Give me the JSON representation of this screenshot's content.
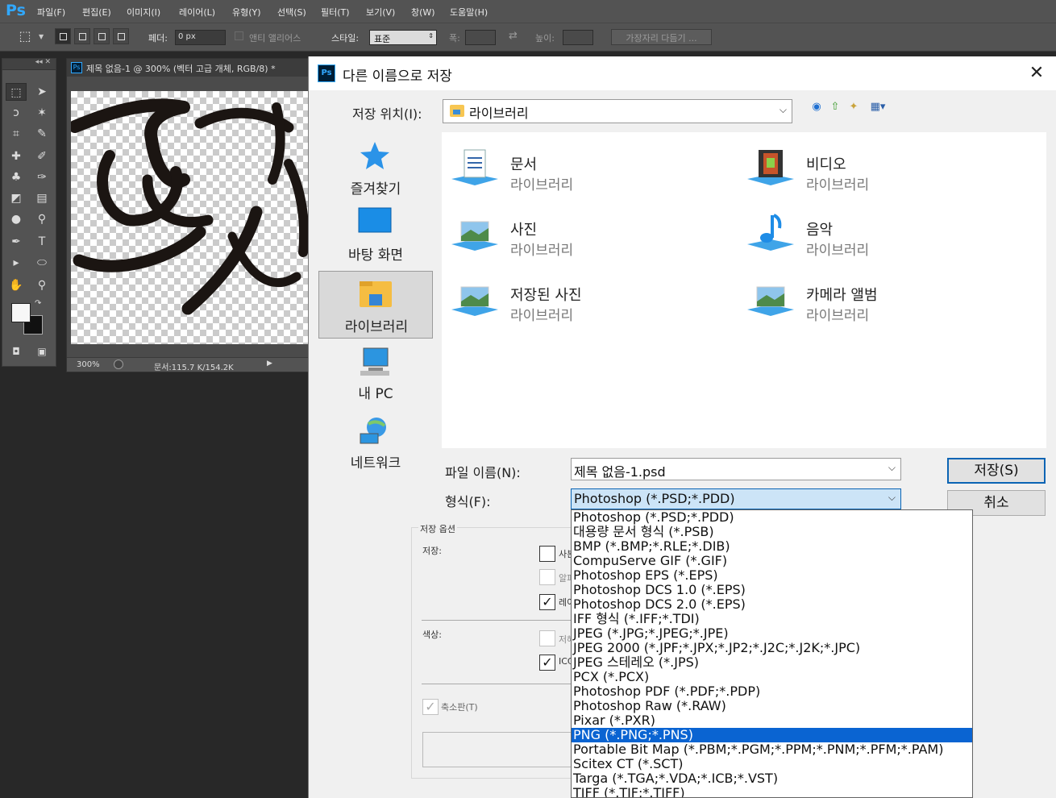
{
  "app": {
    "logo": "Ps",
    "menu": [
      "파일(F)",
      "편집(E)",
      "이미지(I)",
      "레이어(L)",
      "유형(Y)",
      "선택(S)",
      "필터(T)",
      "보기(V)",
      "창(W)",
      "도움말(H)"
    ]
  },
  "options_bar": {
    "feather_label": "페더:",
    "feather_value": "0 px",
    "antialias_label": "앤티 앨리어스",
    "style_label": "스타일:",
    "style_value": "표준",
    "width_label": "폭:",
    "height_label": "높이:",
    "refine_edge": "가장자리 다듬기 ..."
  },
  "toolbox": {
    "collapse": "◂◂ ✕"
  },
  "document": {
    "tab_title": "제목 없음-1 @ 300% (벡터 고급 개체, RGB/8) *",
    "zoom": "300%",
    "doc_size": "문서:115.7 K/154.2K"
  },
  "dialog": {
    "title": "다른 이름으로 저장",
    "save_in_label": "저장 위치(I):",
    "save_in_value": "라이브러리",
    "places": [
      {
        "label": "즐겨찾기",
        "icon": "star-icon"
      },
      {
        "label": "바탕 화면",
        "icon": "desktop-icon"
      },
      {
        "label": "라이브러리",
        "icon": "libraries-icon"
      },
      {
        "label": "내 PC",
        "icon": "computer-icon"
      },
      {
        "label": "네트워크",
        "icon": "network-icon"
      }
    ],
    "libraries": [
      {
        "name": "문서",
        "sub": "라이브러리",
        "icon": "documents-library-icon"
      },
      {
        "name": "비디오",
        "sub": "라이브러리",
        "icon": "videos-library-icon"
      },
      {
        "name": "사진",
        "sub": "라이브러리",
        "icon": "pictures-library-icon"
      },
      {
        "name": "음악",
        "sub": "라이브러리",
        "icon": "music-library-icon"
      },
      {
        "name": "저장된 사진",
        "sub": "라이브러리",
        "icon": "saved-pictures-library-icon"
      },
      {
        "name": "카메라 앨범",
        "sub": "라이브러리",
        "icon": "camera-roll-library-icon"
      }
    ],
    "filename_label": "파일 이름(N):",
    "filename_value": "제목 없음-1.psd",
    "format_label": "형식(F):",
    "format_value": "Photoshop (*.PSD;*.PDD)",
    "save_button": "저장(S)",
    "cancel_button": "취소",
    "formats": [
      "Photoshop (*.PSD;*.PDD)",
      "대용량 문서 형식 (*.PSB)",
      "BMP (*.BMP;*.RLE;*.DIB)",
      "CompuServe GIF (*.GIF)",
      "Photoshop EPS (*.EPS)",
      "Photoshop DCS 1.0 (*.EPS)",
      "Photoshop DCS 2.0 (*.EPS)",
      "IFF 형식 (*.IFF;*.TDI)",
      "JPEG (*.JPG;*.JPEG;*.JPE)",
      "JPEG 2000 (*.JPF;*.JPX;*.JP2;*.J2C;*.J2K;*.JPC)",
      "JPEG 스테레오 (*.JPS)",
      "PCX (*.PCX)",
      "Photoshop PDF (*.PDF;*.PDP)",
      "Photoshop Raw (*.RAW)",
      "Pixar (*.PXR)",
      "PNG (*.PNG;*.PNS)",
      "Portable Bit Map (*.PBM;*.PGM;*.PPM;*.PNM;*.PFM;*.PAM)",
      "Scitex CT (*.SCT)",
      "Targa (*.TGA;*.VDA;*.ICB;*.VST)",
      "TIFF (*.TIF;*.TIFF)"
    ],
    "selected_format": "PNG (*.PNG;*.PNS)",
    "save_options": {
      "title": "저장 옵션",
      "save_label": "저장:",
      "opt1": "사본",
      "opt2": "알파",
      "opt3": "레이",
      "color_label": "색상:",
      "opt4": "저해",
      "opt5": "ICC",
      "thumbnail": "축소판(T)"
    }
  }
}
